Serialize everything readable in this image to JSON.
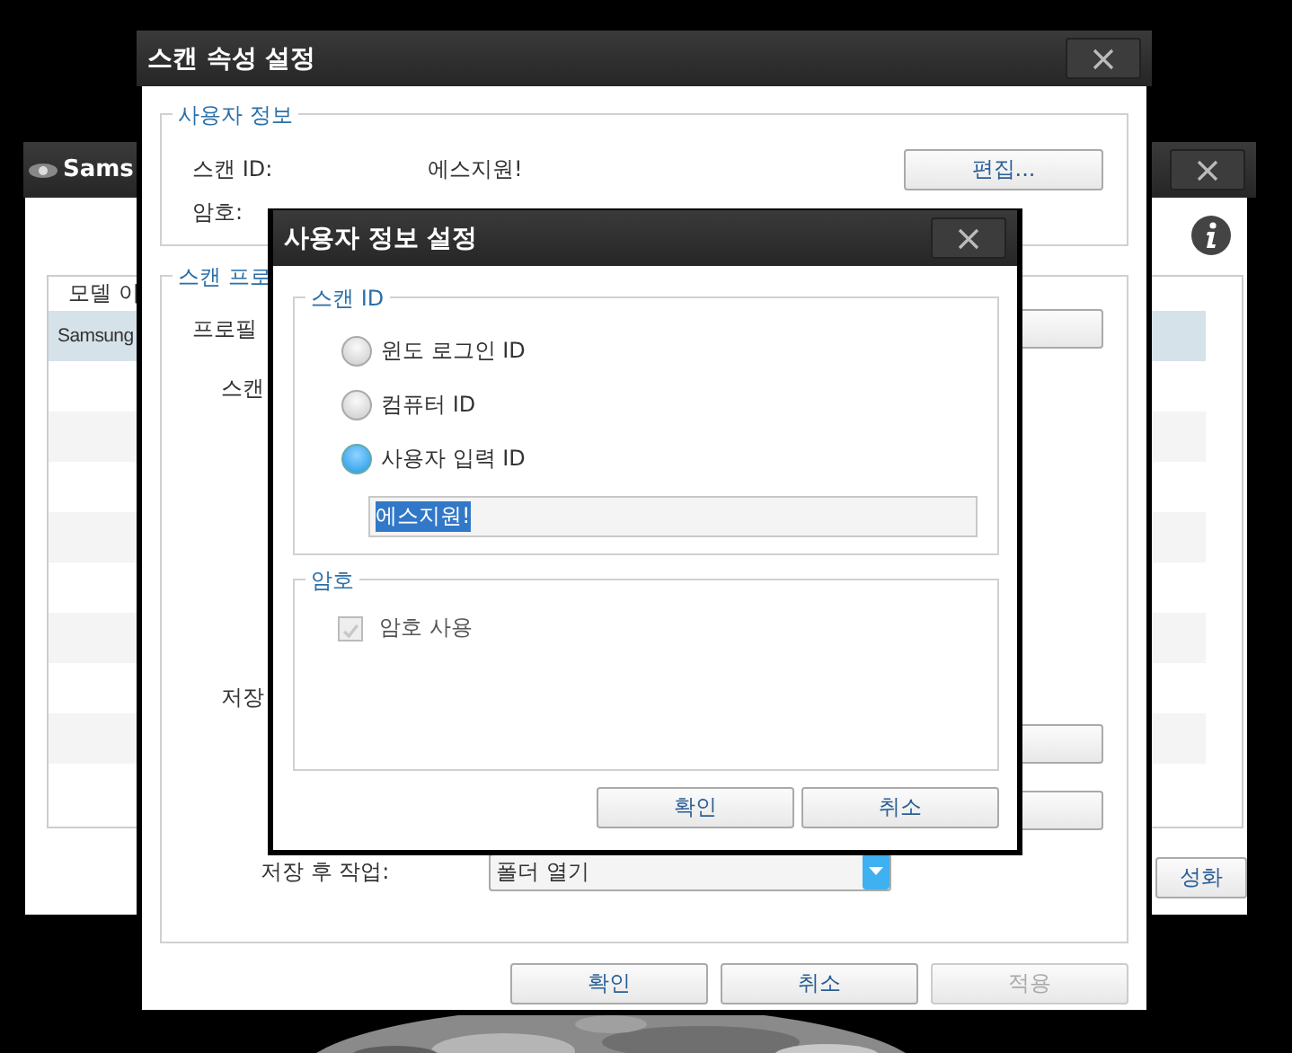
{
  "background_window": {
    "title": "Sams",
    "table": {
      "columns": [
        "모델 이"
      ],
      "rows": [
        {
          "cells": [
            "Samsung"
          ],
          "selected": true
        }
      ]
    },
    "button": "성화"
  },
  "scan_settings_window": {
    "title": "스캔 속성 설정",
    "user_info": {
      "title": "사용자 정보",
      "fields": [
        {
          "label": "스캔 ID:",
          "value": "에스지원!"
        },
        {
          "label": "암호:"
        }
      ],
      "edit_button": "편집..."
    },
    "scan_profile": {
      "title": "스캔 프로",
      "labels": [
        "프로필",
        "스캔",
        "저장"
      ],
      "after_save": {
        "label": "저장 후 작업:",
        "value": "폴더 열기"
      }
    },
    "buttons": [
      {
        "label": "확인",
        "disabled": false
      },
      {
        "label": "취소",
        "disabled": false
      },
      {
        "label": "적용",
        "disabled": true
      }
    ]
  },
  "user_info_dialog": {
    "title": "사용자 정보 설정",
    "scan_id": {
      "title": "스캔 ID",
      "options": [
        {
          "label": "윈도 로그인 ID",
          "selected": false
        },
        {
          "label": "컴퓨터 ID",
          "selected": false
        },
        {
          "label": "사용자 입력 ID",
          "selected": true
        }
      ],
      "value": "에스지원!"
    },
    "password": {
      "title": "암호",
      "use_password": {
        "label": "암호 사용",
        "checked": true,
        "disabled": true
      }
    },
    "buttons": [
      "확인",
      "취소"
    ]
  }
}
